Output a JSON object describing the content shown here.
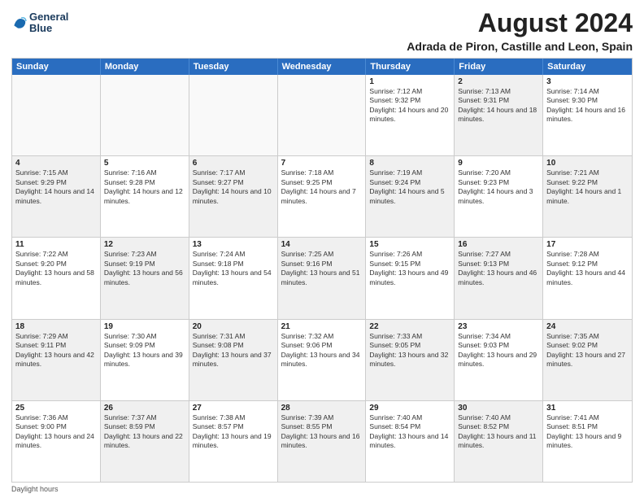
{
  "header": {
    "logo_line1": "General",
    "logo_line2": "Blue",
    "month_year": "August 2024",
    "location": "Adrada de Piron, Castille and Leon, Spain"
  },
  "weekdays": [
    "Sunday",
    "Monday",
    "Tuesday",
    "Wednesday",
    "Thursday",
    "Friday",
    "Saturday"
  ],
  "footer": "Daylight hours",
  "rows": [
    [
      {
        "day": "",
        "sunrise": "",
        "sunset": "",
        "daylight": "",
        "shaded": false,
        "empty": true
      },
      {
        "day": "",
        "sunrise": "",
        "sunset": "",
        "daylight": "",
        "shaded": false,
        "empty": true
      },
      {
        "day": "",
        "sunrise": "",
        "sunset": "",
        "daylight": "",
        "shaded": false,
        "empty": true
      },
      {
        "day": "",
        "sunrise": "",
        "sunset": "",
        "daylight": "",
        "shaded": false,
        "empty": true
      },
      {
        "day": "1",
        "sunrise": "Sunrise: 7:12 AM",
        "sunset": "Sunset: 9:32 PM",
        "daylight": "Daylight: 14 hours and 20 minutes.",
        "shaded": false,
        "empty": false
      },
      {
        "day": "2",
        "sunrise": "Sunrise: 7:13 AM",
        "sunset": "Sunset: 9:31 PM",
        "daylight": "Daylight: 14 hours and 18 minutes.",
        "shaded": true,
        "empty": false
      },
      {
        "day": "3",
        "sunrise": "Sunrise: 7:14 AM",
        "sunset": "Sunset: 9:30 PM",
        "daylight": "Daylight: 14 hours and 16 minutes.",
        "shaded": false,
        "empty": false
      }
    ],
    [
      {
        "day": "4",
        "sunrise": "Sunrise: 7:15 AM",
        "sunset": "Sunset: 9:29 PM",
        "daylight": "Daylight: 14 hours and 14 minutes.",
        "shaded": true,
        "empty": false
      },
      {
        "day": "5",
        "sunrise": "Sunrise: 7:16 AM",
        "sunset": "Sunset: 9:28 PM",
        "daylight": "Daylight: 14 hours and 12 minutes.",
        "shaded": false,
        "empty": false
      },
      {
        "day": "6",
        "sunrise": "Sunrise: 7:17 AM",
        "sunset": "Sunset: 9:27 PM",
        "daylight": "Daylight: 14 hours and 10 minutes.",
        "shaded": true,
        "empty": false
      },
      {
        "day": "7",
        "sunrise": "Sunrise: 7:18 AM",
        "sunset": "Sunset: 9:25 PM",
        "daylight": "Daylight: 14 hours and 7 minutes.",
        "shaded": false,
        "empty": false
      },
      {
        "day": "8",
        "sunrise": "Sunrise: 7:19 AM",
        "sunset": "Sunset: 9:24 PM",
        "daylight": "Daylight: 14 hours and 5 minutes.",
        "shaded": true,
        "empty": false
      },
      {
        "day": "9",
        "sunrise": "Sunrise: 7:20 AM",
        "sunset": "Sunset: 9:23 PM",
        "daylight": "Daylight: 14 hours and 3 minutes.",
        "shaded": false,
        "empty": false
      },
      {
        "day": "10",
        "sunrise": "Sunrise: 7:21 AM",
        "sunset": "Sunset: 9:22 PM",
        "daylight": "Daylight: 14 hours and 1 minute.",
        "shaded": true,
        "empty": false
      }
    ],
    [
      {
        "day": "11",
        "sunrise": "Sunrise: 7:22 AM",
        "sunset": "Sunset: 9:20 PM",
        "daylight": "Daylight: 13 hours and 58 minutes.",
        "shaded": false,
        "empty": false
      },
      {
        "day": "12",
        "sunrise": "Sunrise: 7:23 AM",
        "sunset": "Sunset: 9:19 PM",
        "daylight": "Daylight: 13 hours and 56 minutes.",
        "shaded": true,
        "empty": false
      },
      {
        "day": "13",
        "sunrise": "Sunrise: 7:24 AM",
        "sunset": "Sunset: 9:18 PM",
        "daylight": "Daylight: 13 hours and 54 minutes.",
        "shaded": false,
        "empty": false
      },
      {
        "day": "14",
        "sunrise": "Sunrise: 7:25 AM",
        "sunset": "Sunset: 9:16 PM",
        "daylight": "Daylight: 13 hours and 51 minutes.",
        "shaded": true,
        "empty": false
      },
      {
        "day": "15",
        "sunrise": "Sunrise: 7:26 AM",
        "sunset": "Sunset: 9:15 PM",
        "daylight": "Daylight: 13 hours and 49 minutes.",
        "shaded": false,
        "empty": false
      },
      {
        "day": "16",
        "sunrise": "Sunrise: 7:27 AM",
        "sunset": "Sunset: 9:13 PM",
        "daylight": "Daylight: 13 hours and 46 minutes.",
        "shaded": true,
        "empty": false
      },
      {
        "day": "17",
        "sunrise": "Sunrise: 7:28 AM",
        "sunset": "Sunset: 9:12 PM",
        "daylight": "Daylight: 13 hours and 44 minutes.",
        "shaded": false,
        "empty": false
      }
    ],
    [
      {
        "day": "18",
        "sunrise": "Sunrise: 7:29 AM",
        "sunset": "Sunset: 9:11 PM",
        "daylight": "Daylight: 13 hours and 42 minutes.",
        "shaded": true,
        "empty": false
      },
      {
        "day": "19",
        "sunrise": "Sunrise: 7:30 AM",
        "sunset": "Sunset: 9:09 PM",
        "daylight": "Daylight: 13 hours and 39 minutes.",
        "shaded": false,
        "empty": false
      },
      {
        "day": "20",
        "sunrise": "Sunrise: 7:31 AM",
        "sunset": "Sunset: 9:08 PM",
        "daylight": "Daylight: 13 hours and 37 minutes.",
        "shaded": true,
        "empty": false
      },
      {
        "day": "21",
        "sunrise": "Sunrise: 7:32 AM",
        "sunset": "Sunset: 9:06 PM",
        "daylight": "Daylight: 13 hours and 34 minutes.",
        "shaded": false,
        "empty": false
      },
      {
        "day": "22",
        "sunrise": "Sunrise: 7:33 AM",
        "sunset": "Sunset: 9:05 PM",
        "daylight": "Daylight: 13 hours and 32 minutes.",
        "shaded": true,
        "empty": false
      },
      {
        "day": "23",
        "sunrise": "Sunrise: 7:34 AM",
        "sunset": "Sunset: 9:03 PM",
        "daylight": "Daylight: 13 hours and 29 minutes.",
        "shaded": false,
        "empty": false
      },
      {
        "day": "24",
        "sunrise": "Sunrise: 7:35 AM",
        "sunset": "Sunset: 9:02 PM",
        "daylight": "Daylight: 13 hours and 27 minutes.",
        "shaded": true,
        "empty": false
      }
    ],
    [
      {
        "day": "25",
        "sunrise": "Sunrise: 7:36 AM",
        "sunset": "Sunset: 9:00 PM",
        "daylight": "Daylight: 13 hours and 24 minutes.",
        "shaded": false,
        "empty": false
      },
      {
        "day": "26",
        "sunrise": "Sunrise: 7:37 AM",
        "sunset": "Sunset: 8:59 PM",
        "daylight": "Daylight: 13 hours and 22 minutes.",
        "shaded": true,
        "empty": false
      },
      {
        "day": "27",
        "sunrise": "Sunrise: 7:38 AM",
        "sunset": "Sunset: 8:57 PM",
        "daylight": "Daylight: 13 hours and 19 minutes.",
        "shaded": false,
        "empty": false
      },
      {
        "day": "28",
        "sunrise": "Sunrise: 7:39 AM",
        "sunset": "Sunset: 8:55 PM",
        "daylight": "Daylight: 13 hours and 16 minutes.",
        "shaded": true,
        "empty": false
      },
      {
        "day": "29",
        "sunrise": "Sunrise: 7:40 AM",
        "sunset": "Sunset: 8:54 PM",
        "daylight": "Daylight: 13 hours and 14 minutes.",
        "shaded": false,
        "empty": false
      },
      {
        "day": "30",
        "sunrise": "Sunrise: 7:40 AM",
        "sunset": "Sunset: 8:52 PM",
        "daylight": "Daylight: 13 hours and 11 minutes.",
        "shaded": true,
        "empty": false
      },
      {
        "day": "31",
        "sunrise": "Sunrise: 7:41 AM",
        "sunset": "Sunset: 8:51 PM",
        "daylight": "Daylight: 13 hours and 9 minutes.",
        "shaded": false,
        "empty": false
      }
    ]
  ]
}
